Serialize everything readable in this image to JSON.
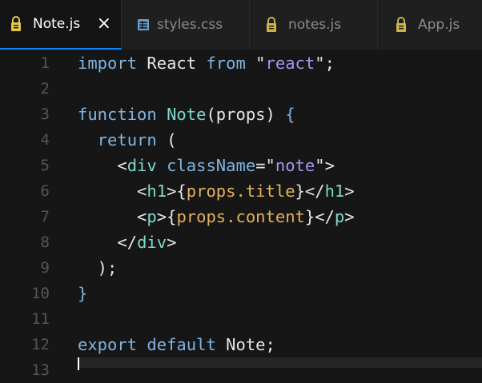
{
  "tabs": [
    {
      "label": "Note.js",
      "icon": "lock-icon",
      "active": true,
      "close": "×"
    },
    {
      "label": "styles.css",
      "icon": "css-file-icon",
      "active": false
    },
    {
      "label": "notes.js",
      "icon": "lock-icon",
      "active": false
    },
    {
      "label": "App.js",
      "icon": "lock-icon",
      "active": false
    }
  ],
  "colors": {
    "keyword": "#7fb4e3",
    "function": "#7ed8c9",
    "string": "#a396f0",
    "variable": "#e4b15c",
    "background": "#161616",
    "active_tab_border": "#0a84ff"
  },
  "lines": [
    {
      "num": "1",
      "tokens": [
        {
          "t": "import",
          "c": "kw"
        },
        {
          "t": " React ",
          "c": "plain"
        },
        {
          "t": "from",
          "c": "kw"
        },
        {
          "t": " \"",
          "c": "plain"
        },
        {
          "t": "react",
          "c": "str"
        },
        {
          "t": "\";",
          "c": "plain"
        }
      ]
    },
    {
      "num": "2",
      "tokens": []
    },
    {
      "num": "3",
      "tokens": [
        {
          "t": "function",
          "c": "kw"
        },
        {
          "t": " ",
          "c": "plain"
        },
        {
          "t": "Note",
          "c": "fn"
        },
        {
          "t": "(props) ",
          "c": "plain"
        },
        {
          "t": "{",
          "c": "brace"
        }
      ]
    },
    {
      "num": "4",
      "tokens": [
        {
          "t": "  return",
          "c": "kw"
        },
        {
          "t": " (",
          "c": "plain"
        }
      ]
    },
    {
      "num": "5",
      "tokens": [
        {
          "t": "    <",
          "c": "plain"
        },
        {
          "t": "div",
          "c": "tag"
        },
        {
          "t": " ",
          "c": "plain"
        },
        {
          "t": "className",
          "c": "attr"
        },
        {
          "t": "=\"",
          "c": "plain"
        },
        {
          "t": "note",
          "c": "str"
        },
        {
          "t": "\">",
          "c": "plain"
        }
      ]
    },
    {
      "num": "6",
      "tokens": [
        {
          "t": "      <",
          "c": "plain"
        },
        {
          "t": "h1",
          "c": "tag"
        },
        {
          "t": ">{",
          "c": "plain"
        },
        {
          "t": "props.title",
          "c": "var"
        },
        {
          "t": "}</",
          "c": "plain"
        },
        {
          "t": "h1",
          "c": "tag"
        },
        {
          "t": ">",
          "c": "plain"
        }
      ]
    },
    {
      "num": "7",
      "tokens": [
        {
          "t": "      <",
          "c": "plain"
        },
        {
          "t": "p",
          "c": "tag"
        },
        {
          "t": ">{",
          "c": "plain"
        },
        {
          "t": "props.content",
          "c": "var"
        },
        {
          "t": "}</",
          "c": "plain"
        },
        {
          "t": "p",
          "c": "tag"
        },
        {
          "t": ">",
          "c": "plain"
        }
      ]
    },
    {
      "num": "8",
      "tokens": [
        {
          "t": "    </",
          "c": "plain"
        },
        {
          "t": "div",
          "c": "tag"
        },
        {
          "t": ">",
          "c": "plain"
        }
      ]
    },
    {
      "num": "9",
      "tokens": [
        {
          "t": "  );",
          "c": "plain"
        }
      ]
    },
    {
      "num": "10",
      "tokens": [
        {
          "t": "}",
          "c": "brace"
        }
      ]
    },
    {
      "num": "11",
      "tokens": []
    },
    {
      "num": "12",
      "tokens": [
        {
          "t": "export",
          "c": "kw"
        },
        {
          "t": " ",
          "c": "plain"
        },
        {
          "t": "default",
          "c": "kw"
        },
        {
          "t": " Note;",
          "c": "plain"
        }
      ]
    },
    {
      "num": "13",
      "tokens": []
    }
  ]
}
